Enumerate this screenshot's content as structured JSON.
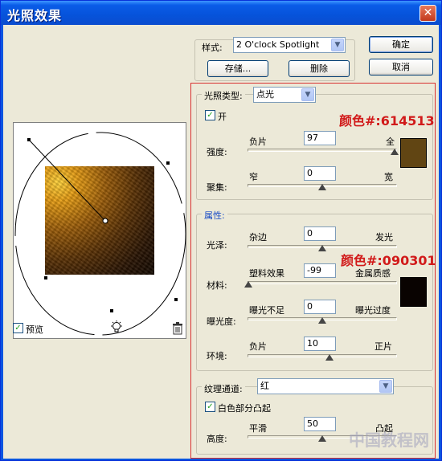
{
  "window": {
    "title": "光照效果",
    "close_glyph": "✕"
  },
  "style_row": {
    "label": "样式:",
    "value": "2 O'clock Spotlight",
    "save_label": "存储...",
    "delete_label": "删除"
  },
  "buttons": {
    "ok": "确定",
    "cancel": "取消"
  },
  "light_type": {
    "label": "光照类型:",
    "value": "点光",
    "on_label": "开",
    "on_checked": true,
    "color_annotation": "颜色#:614513",
    "color": "#614513",
    "intensity": {
      "label": "强度:",
      "left": "负片",
      "right": "全",
      "value": "97",
      "fraction": 0.985
    },
    "focus": {
      "label": "聚集:",
      "left": "窄",
      "right": "宽",
      "value": "0",
      "fraction": 0.5
    }
  },
  "properties": {
    "title": "属性:",
    "color_annotation": "颜色#:090301",
    "color": "#090301",
    "gloss": {
      "label": "光泽:",
      "left": "杂边",
      "right": "发光",
      "value": "0",
      "fraction": 0.5
    },
    "material": {
      "label": "材料:",
      "left": "塑料效果",
      "right": "金属质感",
      "value": "-99",
      "fraction": 0.005
    },
    "exposure": {
      "label": "曝光度:",
      "left": "曝光不足",
      "right": "曝光过度",
      "value": "0",
      "fraction": 0.5
    },
    "ambience": {
      "label": "环境:",
      "left": "负片",
      "right": "正片",
      "value": "10",
      "fraction": 0.55
    }
  },
  "texture": {
    "label": "纹理通道:",
    "value": "红",
    "white_high_label": "白色部分凸起",
    "white_high_checked": true,
    "height": {
      "label": "高度:",
      "left": "平滑",
      "right": "凸起",
      "value": "50",
      "fraction": 0.5
    }
  },
  "preview": {
    "preview_label": "预览",
    "preview_checked": true,
    "lightbulb_icon": "lightbulb-icon",
    "trash_icon": "trash-icon"
  },
  "watermark": "中国教程网"
}
